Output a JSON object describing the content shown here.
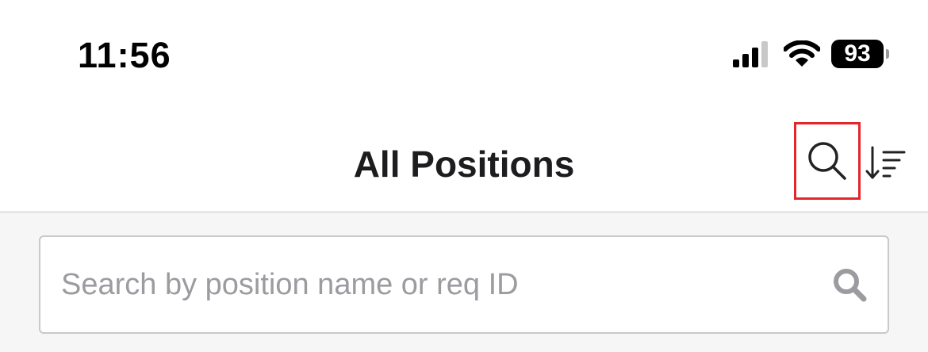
{
  "status_bar": {
    "time": "11:56",
    "battery_level": "93",
    "icons": [
      "cellular-signal-icon",
      "wifi-icon",
      "battery-icon"
    ]
  },
  "nav": {
    "title": "All Positions",
    "actions": [
      {
        "icon": "search-icon",
        "highlighted": true
      },
      {
        "icon": "sort-icon"
      }
    ]
  },
  "search": {
    "placeholder": "Search by position name or req ID",
    "value": "",
    "icon": "search-icon"
  },
  "colors": {
    "highlight": "#e3262b",
    "text_primary": "#1d1d1f",
    "placeholder": "#9b9ba0",
    "content_bg": "#f6f6f7"
  }
}
